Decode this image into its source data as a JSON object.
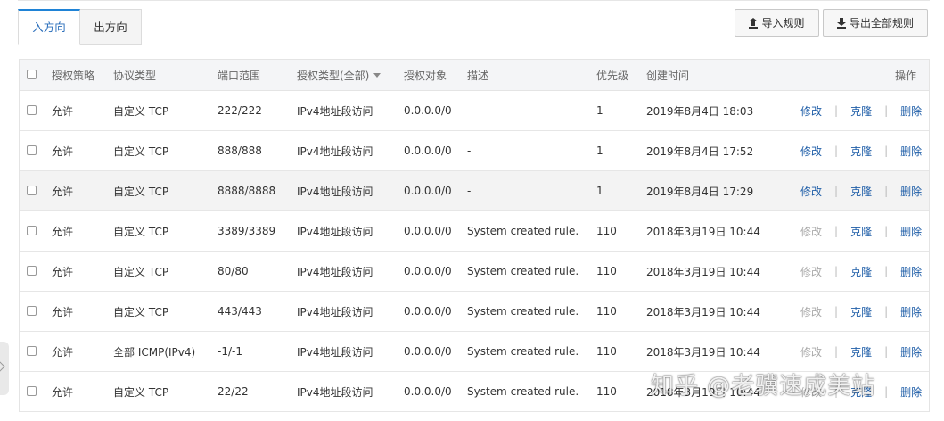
{
  "tabs": [
    {
      "label": "入方向",
      "active": true
    },
    {
      "label": "出方向",
      "active": false
    }
  ],
  "toolbar": {
    "import_label": "导入规则",
    "export_label": "导出全部规则"
  },
  "table": {
    "headers": {
      "policy": "授权策略",
      "protocol": "协议类型",
      "port": "端口范围",
      "auth_type": "授权类型(全部)",
      "auth_object": "授权对象",
      "desc": "描述",
      "priority": "优先级",
      "created": "创建时间",
      "ops": "操作"
    },
    "op_labels": {
      "edit": "修改",
      "clone": "克隆",
      "delete": "删除"
    },
    "rows": [
      {
        "policy": "允许",
        "protocol": "自定义 TCP",
        "port": "222/222",
        "auth_type": "IPv4地址段访问",
        "auth_object": "0.0.0.0/0",
        "desc": "-",
        "priority": "1",
        "created": "2019年8月4日 18:03",
        "edit_enabled": true
      },
      {
        "policy": "允许",
        "protocol": "自定义 TCP",
        "port": "888/888",
        "auth_type": "IPv4地址段访问",
        "auth_object": "0.0.0.0/0",
        "desc": "-",
        "priority": "1",
        "created": "2019年8月4日 17:52",
        "edit_enabled": true
      },
      {
        "policy": "允许",
        "protocol": "自定义 TCP",
        "port": "8888/8888",
        "auth_type": "IPv4地址段访问",
        "auth_object": "0.0.0.0/0",
        "desc": "-",
        "priority": "1",
        "created": "2019年8月4日 17:29",
        "edit_enabled": true,
        "highlighted": true
      },
      {
        "policy": "允许",
        "protocol": "自定义 TCP",
        "port": "3389/3389",
        "auth_type": "IPv4地址段访问",
        "auth_object": "0.0.0.0/0",
        "desc": "System created rule.",
        "priority": "110",
        "created": "2018年3月19日 10:44",
        "edit_enabled": false
      },
      {
        "policy": "允许",
        "protocol": "自定义 TCP",
        "port": "80/80",
        "auth_type": "IPv4地址段访问",
        "auth_object": "0.0.0.0/0",
        "desc": "System created rule.",
        "priority": "110",
        "created": "2018年3月19日 10:44",
        "edit_enabled": false
      },
      {
        "policy": "允许",
        "protocol": "自定义 TCP",
        "port": "443/443",
        "auth_type": "IPv4地址段访问",
        "auth_object": "0.0.0.0/0",
        "desc": "System created rule.",
        "priority": "110",
        "created": "2018年3月19日 10:44",
        "edit_enabled": false
      },
      {
        "policy": "允许",
        "protocol": "全部 ICMP(IPv4)",
        "port": "-1/-1",
        "auth_type": "IPv4地址段访问",
        "auth_object": "0.0.0.0/0",
        "desc": "System created rule.",
        "priority": "110",
        "created": "2018年3月19日 10:44",
        "edit_enabled": false
      },
      {
        "policy": "允许",
        "protocol": "自定义 TCP",
        "port": "22/22",
        "auth_type": "IPv4地址段访问",
        "auth_object": "0.0.0.0/0",
        "desc": "System created rule.",
        "priority": "110",
        "created": "2018年3月19日 10:44",
        "edit_enabled": false
      }
    ]
  },
  "watermark": "知乎 @老骥速成美站",
  "colors": {
    "accent": "#1f83d6",
    "link": "#1f5ea8",
    "disabled": "#aaaaaa",
    "header_bg": "#f4f5f7"
  }
}
